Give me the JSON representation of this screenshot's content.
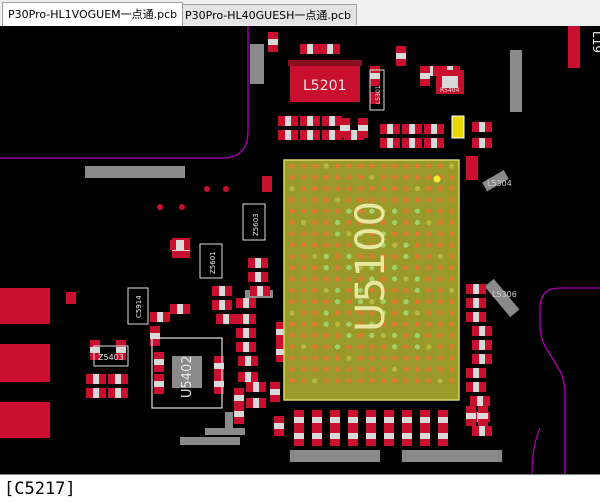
{
  "tabs": [
    {
      "label": "P30Pro-HL1VOGUEM一点通.pcb",
      "active": true
    },
    {
      "label": "P30Pro-HL40GUESH一点通.pcb",
      "active": false
    }
  ],
  "board": {
    "labels": {
      "l5201": "L5201",
      "u5100": "U5100",
      "u5402": "U5402",
      "z5403": "Z5403",
      "z5603": "Z5603",
      "z5601": "Z5601",
      "c5914": "C5914",
      "l5301": "L5301",
      "l5304": "L5304",
      "l5306": "L5306",
      "r5404": "R5404",
      "l19": "L19"
    },
    "colors": {
      "background": "#000000",
      "pad_red": "#c8102e",
      "pad_white": "#d9d9d9",
      "chip_fill": "#9a9a2a",
      "ball_orange": "#e07a2e",
      "ball_green": "#9fd36a",
      "outline_magenta": "#b000b0",
      "component_gray": "#8a8a8a",
      "label_text": "#e8e8e8"
    }
  },
  "status_bar": {
    "text": "[C5217]"
  }
}
